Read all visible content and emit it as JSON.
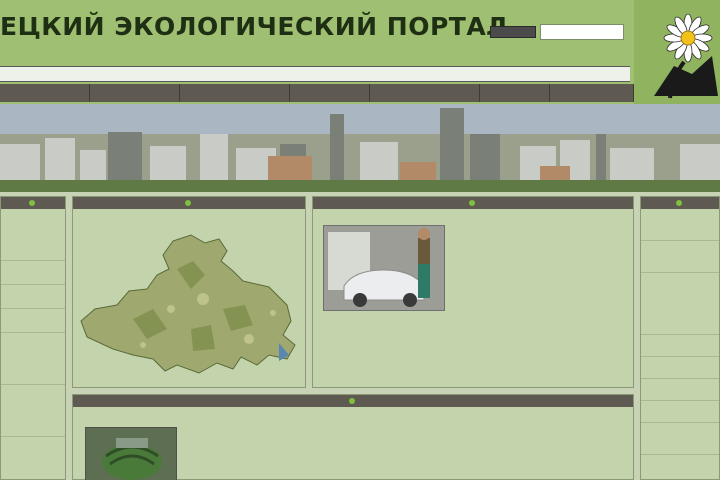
{
  "header": {
    "site_title": "ЕЦКИЙ ЭКОЛОГИЧЕСКИЙ ПОРТАЛ"
  },
  "colors": {
    "header_bg": "#9fbf72",
    "page_bg": "#c7d3b4",
    "nav_bg": "#5e5a52",
    "panel_bg": "#c3d3ac",
    "accent_dot": "#7fc13f"
  },
  "icons": {
    "logo": "daisy-flower-logo",
    "panel_marker": "green-dot-icon"
  }
}
